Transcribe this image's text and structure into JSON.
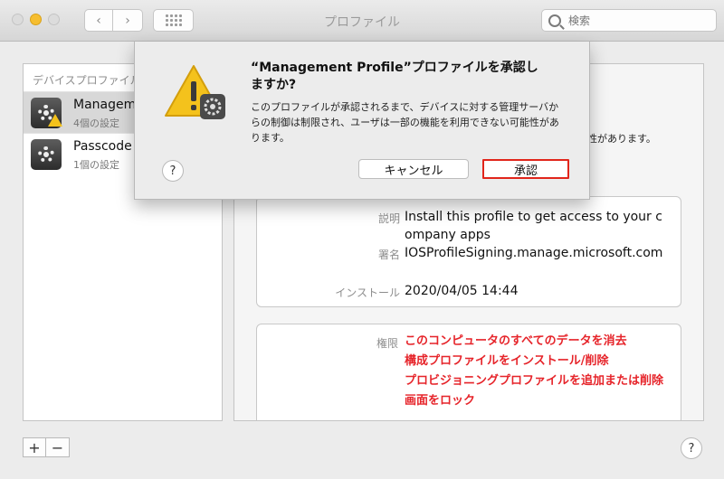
{
  "toolbar": {
    "back_glyph": "‹",
    "forward_glyph": "›",
    "title": "プロファイル",
    "search_placeholder": "検索"
  },
  "sidebar": {
    "header": "デバイスプロファイル",
    "items": [
      {
        "name": "Manageme",
        "subtitle": "4個の設定",
        "icon": "profile-gear-icon",
        "warning": true
      },
      {
        "name": "Passcode",
        "subtitle": "1個の設定",
        "icon": "profile-gear-icon",
        "warning": false
      }
    ],
    "add_label": "+",
    "remove_label": "−"
  },
  "detail": {
    "peek_text": "性があります。",
    "description_label": "説明",
    "description_value": "Install this profile to get access to your company apps",
    "signed_label": "署名",
    "signed_value": "IOSProfileSigning.manage.microsoft.com",
    "installed_label": "インストール",
    "installed_value": "2020/04/05 14:44",
    "permissions_label": "権限",
    "permissions": [
      "このコンピュータのすべてのデータを消去",
      "構成プロファイルをインストール/削除",
      "プロビジョニングプロファイルを追加または削除",
      "画面をロック"
    ]
  },
  "dialog": {
    "title": "“Management Profile”プロファイルを承認しますか?",
    "message": "このプロファイルが承認されるまで、デバイスに対する管理サーバからの制御は制限され、ユーザは一部の機能を利用できない可能性があります。",
    "help_label": "?",
    "cancel_label": "キャンセル",
    "approve_label": "承認"
  },
  "help_label": "?",
  "colors": {
    "highlight_red": "#e1251b",
    "warning_yellow": "#f4c21c",
    "permission_red": "#e6242a"
  }
}
